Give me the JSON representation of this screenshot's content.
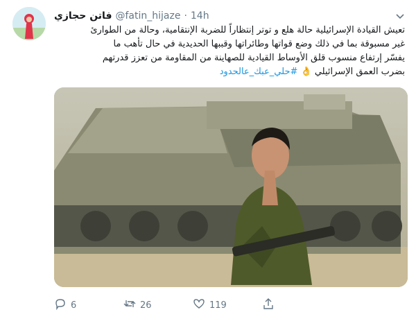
{
  "user": {
    "display_name": "فاتن حجازي",
    "handle": "@fatin_hijaze",
    "separator": "·",
    "time": "14h"
  },
  "tweet": {
    "text_lines": [
      "تعيش القيادة الإسرائيلية حالة هلع و توتر إنتظاراً للضربة الإنتقامية، وحالة من الطوارئ",
      "غير مسبوقة بما في ذلك وضع قواتها وطائراتها وقببها الحديدية في حال تأهب ما",
      "يفسّر إرتفاع منسوب قلق الأوساط القيادية للصهاينة من المقاومة من تعزز قدرتهم",
      "بضرب العمق الإسرائيلي 👌"
    ],
    "hashtag": "#حلي_عبك_عالحدود"
  },
  "actions": {
    "replies": "6",
    "retweets": "26",
    "likes": "119"
  },
  "icons": {
    "reply": "reply-icon",
    "retweet": "retweet-icon",
    "like": "heart-icon",
    "share": "share-icon",
    "more": "chevron-down-icon"
  },
  "colors": {
    "link": "#1b95e0",
    "muted": "#657786",
    "text": "#14171a"
  }
}
